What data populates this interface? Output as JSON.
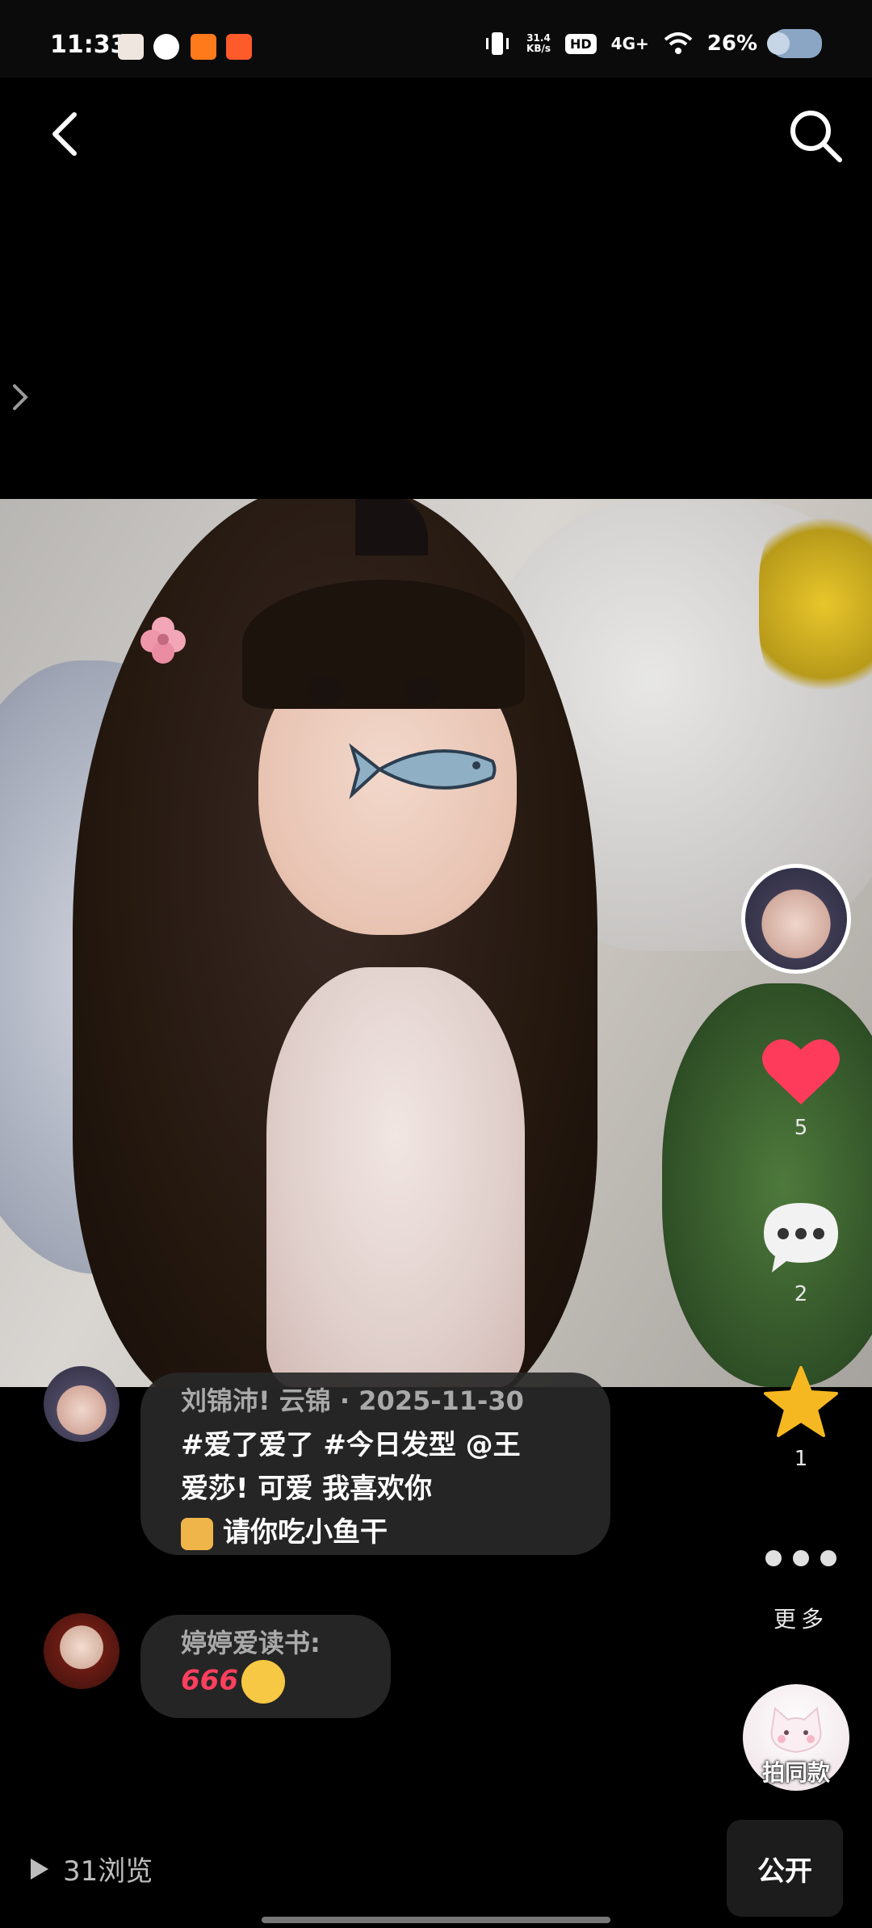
{
  "status_bar": {
    "time": "11:33",
    "net_speed_value": "31.4",
    "net_speed_unit": "KB/s",
    "hd": "HD",
    "network": "4G+",
    "battery": "26%"
  },
  "post": {
    "author_line": "刘锦沛! 云锦 · 2025-11-30",
    "caption_line1": "#爱了爱了 #今日发型 @王",
    "caption_line2": "爱莎! 可爱 我喜欢你",
    "caption_line3": "请你吃小鱼干"
  },
  "comment": {
    "author": "婷婷爱读书:",
    "text": "666"
  },
  "actions": {
    "likes": "5",
    "comments": "2",
    "favorites": "1",
    "more_label": "更多",
    "shoot_same_label": "拍同款"
  },
  "footer": {
    "views": "31浏览",
    "visibility": "公开"
  },
  "colors": {
    "like": "#ff3b5c",
    "favorite": "#f5b820",
    "background": "#000000"
  },
  "icons": [
    "back-icon",
    "search-icon",
    "chevron-right-icon",
    "heart-icon",
    "comment-icon",
    "star-icon",
    "more-dots-icon",
    "play-icon"
  ]
}
